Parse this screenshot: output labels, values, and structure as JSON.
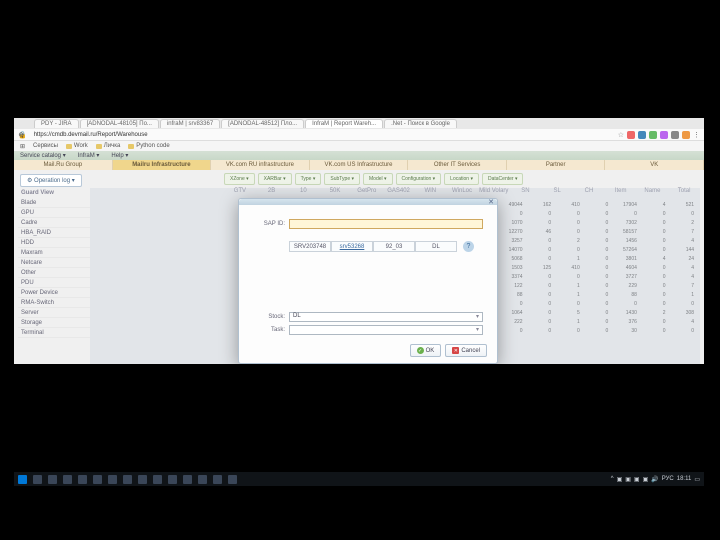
{
  "browser": {
    "tabs": [
      {
        "label": "PDY - JIRA"
      },
      {
        "label": "[ADNODAL-48105] По..."
      },
      {
        "label": "infraM | srv83367"
      },
      {
        "label": "[ADNODAL-48512] Пло..."
      },
      {
        "label": "InfraM | Report Wareh..."
      },
      {
        "label": ".Net - Поиск в Google"
      }
    ],
    "url": "https://cmdb.devmail.ru/Report/Warehouse",
    "bookmarks": [
      "Сервисы",
      "Work",
      "Личка",
      "Python code"
    ]
  },
  "window_controls": {
    "min": "—",
    "max": "▭",
    "close": "✕"
  },
  "app": {
    "menu": [
      "Service catalog ▾",
      "InfraM ▾",
      "Help ▾"
    ],
    "section_tabs": [
      "Mail.Ru Group",
      "Mailru Infrastructure",
      "VK.com RU infrastructure",
      "VK.com US Infrastructure",
      "Other IT Services",
      "Partner",
      "VK"
    ],
    "section_active": 1,
    "operation_btn": "⚙ Operation log ▾",
    "filters": [
      "XZone ▾",
      "XARBar ▾",
      "Type ▾",
      "SubType ▾",
      "Model ▾",
      "Configuration ▾",
      "Location ▾",
      "DataCenter ▾"
    ],
    "col_headers": [
      "GTV",
      "2B",
      "10",
      "50K",
      "GetPro",
      "GAS402",
      "WIN",
      "WinLoc",
      "Mild Volary",
      "SN",
      "SL",
      "CH",
      "Item",
      "Name",
      "Total"
    ]
  },
  "sidebar": {
    "header": "Guard View",
    "items": [
      "Blade",
      "GPU",
      "Cadre",
      "HBA_RAID",
      "HDD",
      "Maxram",
      "Netcare",
      "Other",
      "PDU",
      "Power Device",
      "RMA-Switch",
      "Server",
      "Storage",
      "Terminal"
    ]
  },
  "data_rows": [
    [
      "49044",
      "162",
      "410",
      "0",
      "17904",
      "4",
      "521"
    ],
    [
      "0",
      "0",
      "0",
      "0",
      "0",
      "0",
      "0"
    ],
    [
      "1070",
      "0",
      "0",
      "0",
      "7302",
      "0",
      "2"
    ],
    [
      "12270",
      "46",
      "0",
      "0",
      "58157",
      "0",
      "7"
    ],
    [
      "3257",
      "0",
      "2",
      "0",
      "1456",
      "0",
      "4"
    ],
    [
      "14070",
      "0",
      "0",
      "0",
      "57264",
      "0",
      "144"
    ],
    [
      "5068",
      "0",
      "1",
      "0",
      "3801",
      "4",
      "24"
    ],
    [
      "1503",
      "125",
      "410",
      "0",
      "4604",
      "0",
      "4"
    ],
    [
      "3374",
      "0",
      "0",
      "0",
      "3727",
      "0",
      "4"
    ],
    [
      "122",
      "0",
      "1",
      "0",
      "229",
      "0",
      "7"
    ],
    [
      "88",
      "0",
      "1",
      "0",
      "88",
      "0",
      "1"
    ],
    [
      "0",
      "0",
      "0",
      "0",
      "0",
      "0",
      "0"
    ],
    [
      "1064",
      "0",
      "5",
      "0",
      "1430",
      "2",
      "308"
    ],
    [
      "222",
      "0",
      "1",
      "0",
      "376",
      "0",
      "4"
    ],
    [
      "0",
      "0",
      "0",
      "0",
      "30",
      "0",
      "0"
    ]
  ],
  "dialog": {
    "field_label": "SAP ID:",
    "info_cells": [
      "SRV203748",
      "srv53268",
      "92_03",
      "DL"
    ],
    "stock_label": "Stock:",
    "stock_value": "DL",
    "task_label": "Task:",
    "task_value": "",
    "ok": "OK",
    "cancel": "Cancel"
  },
  "taskbar": {
    "tray_lang": "РУС",
    "tray_time": "18:11"
  }
}
